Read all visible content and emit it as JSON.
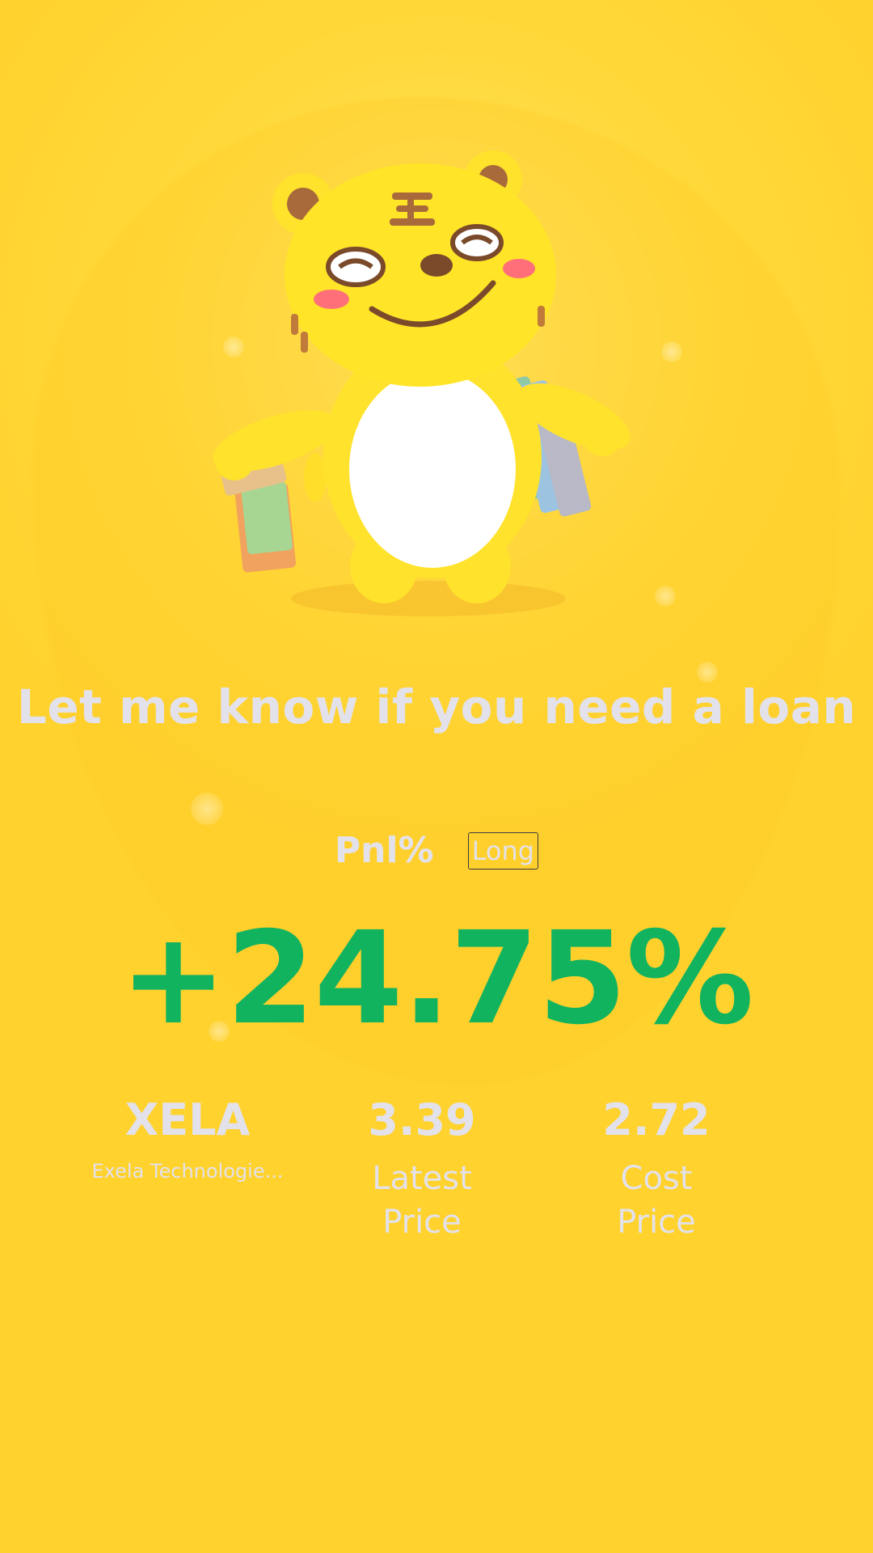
{
  "headline": "Let me know if you need a loan",
  "pnl": {
    "label": "Pnl%",
    "side": "Long",
    "value": "+24.75%",
    "value_color": "#12b35f"
  },
  "stock": {
    "symbol": "XELA",
    "name": "Exela Technologie..."
  },
  "latest_price": {
    "value": "3.39",
    "label": "Latest Price"
  },
  "cost_price": {
    "value": "2.72",
    "label": "Cost Price"
  },
  "mascot": {
    "icon": "tiger-mascot-with-shopping-bags"
  },
  "colors": {
    "background": "#ffd93a",
    "text": "#e3e1ea",
    "gain": "#12b35f"
  }
}
